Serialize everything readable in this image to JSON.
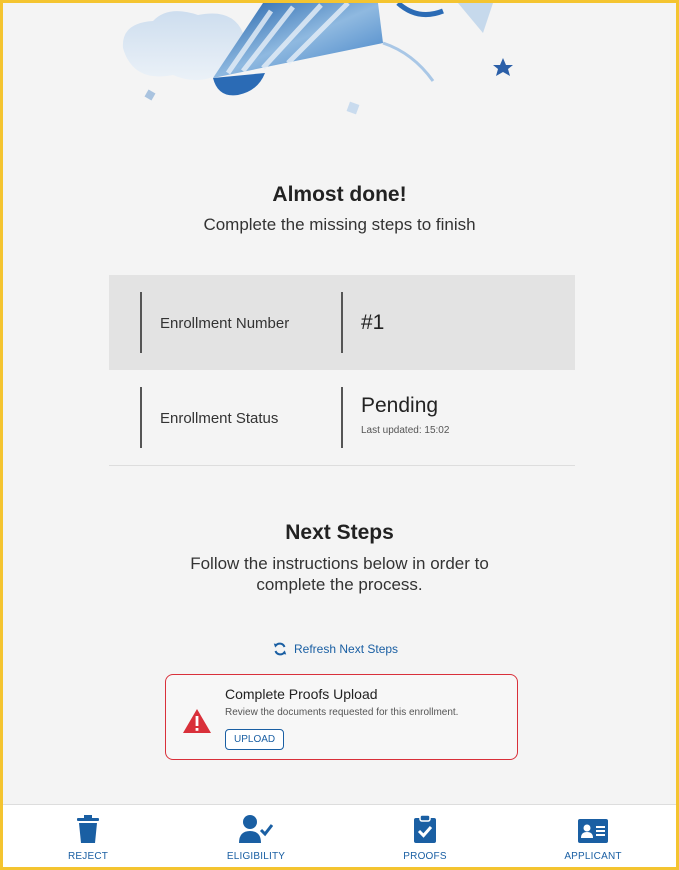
{
  "header": {
    "title": "Almost done!",
    "subtitle": "Complete the missing steps to finish"
  },
  "enrollment": {
    "number_label": "Enrollment Number",
    "number_value": "#1",
    "status_label": "Enrollment Status",
    "status_value": "Pending",
    "last_updated": "Last updated: 15:02"
  },
  "next_steps": {
    "title": "Next Steps",
    "description": "Follow the instructions below in order to complete the process.",
    "refresh_label": "Refresh Next Steps"
  },
  "step_card": {
    "title": "Complete Proofs Upload",
    "description": "Review the documents requested for this enrollment.",
    "button_label": "UPLOAD",
    "icon": "warning-icon",
    "border_color": "#d9303a"
  },
  "bottom_nav": {
    "items": [
      {
        "label": "REJECT",
        "icon": "trash-icon"
      },
      {
        "label": "ELIGIBILITY",
        "icon": "user-check-icon"
      },
      {
        "label": "PROOFS",
        "icon": "clipboard-check-icon"
      },
      {
        "label": "APPLICANT",
        "icon": "id-card-icon"
      }
    ]
  },
  "colors": {
    "accent": "#1a5fa3",
    "frame": "#f4c430",
    "alert": "#d9303a"
  }
}
